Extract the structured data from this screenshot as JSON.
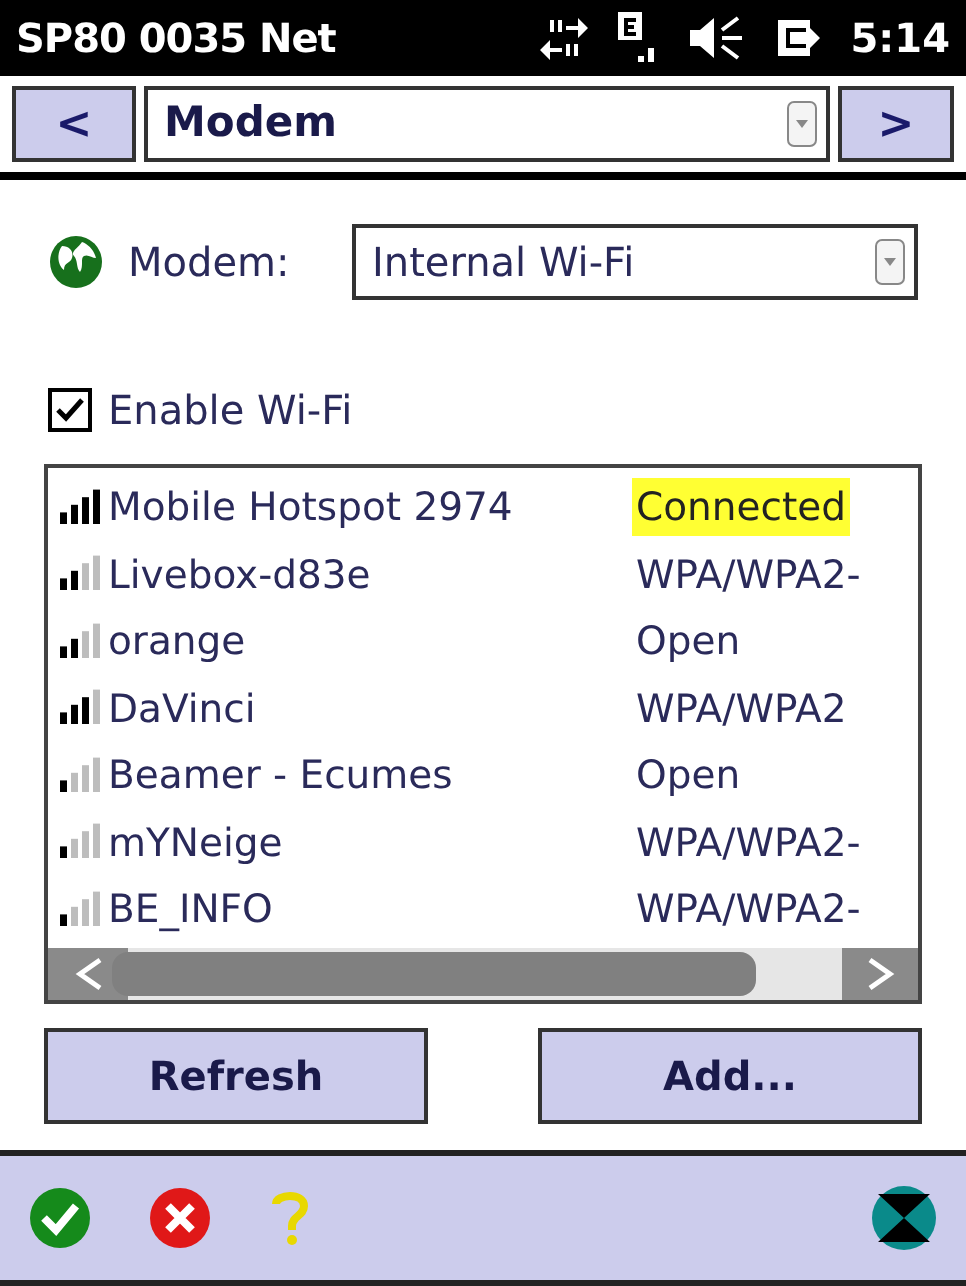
{
  "status_bar": {
    "title": "SP80 0035 Net",
    "time": "5:14"
  },
  "nav": {
    "prev": "<",
    "page": "Modem",
    "next": ">"
  },
  "modem": {
    "label": "Modem:",
    "value": "Internal Wi-Fi"
  },
  "enable_wifi": {
    "label": "Enable Wi-Fi",
    "checked": true
  },
  "networks": [
    {
      "name": "Mobile Hotspot 2974",
      "security": "Connected",
      "highlighted": true,
      "kind": "full"
    },
    {
      "name": "Livebox-d83e",
      "security": "WPA/WPA2-",
      "highlighted": false,
      "kind": "fair"
    },
    {
      "name": "orange",
      "security": "Open",
      "highlighted": false,
      "kind": "fair"
    },
    {
      "name": "DaVinci",
      "security": "WPA/WPA2",
      "highlighted": false,
      "kind": "good"
    },
    {
      "name": "Beamer - Ecumes",
      "security": "Open",
      "highlighted": false,
      "kind": "weak"
    },
    {
      "name": "mYNeige",
      "security": "WPA/WPA2-",
      "highlighted": false,
      "kind": "weak"
    },
    {
      "name": "BE_INFO",
      "security": "WPA/WPA2-",
      "highlighted": false,
      "kind": "weak"
    }
  ],
  "buttons": [
    "Refresh",
    "Add..."
  ]
}
